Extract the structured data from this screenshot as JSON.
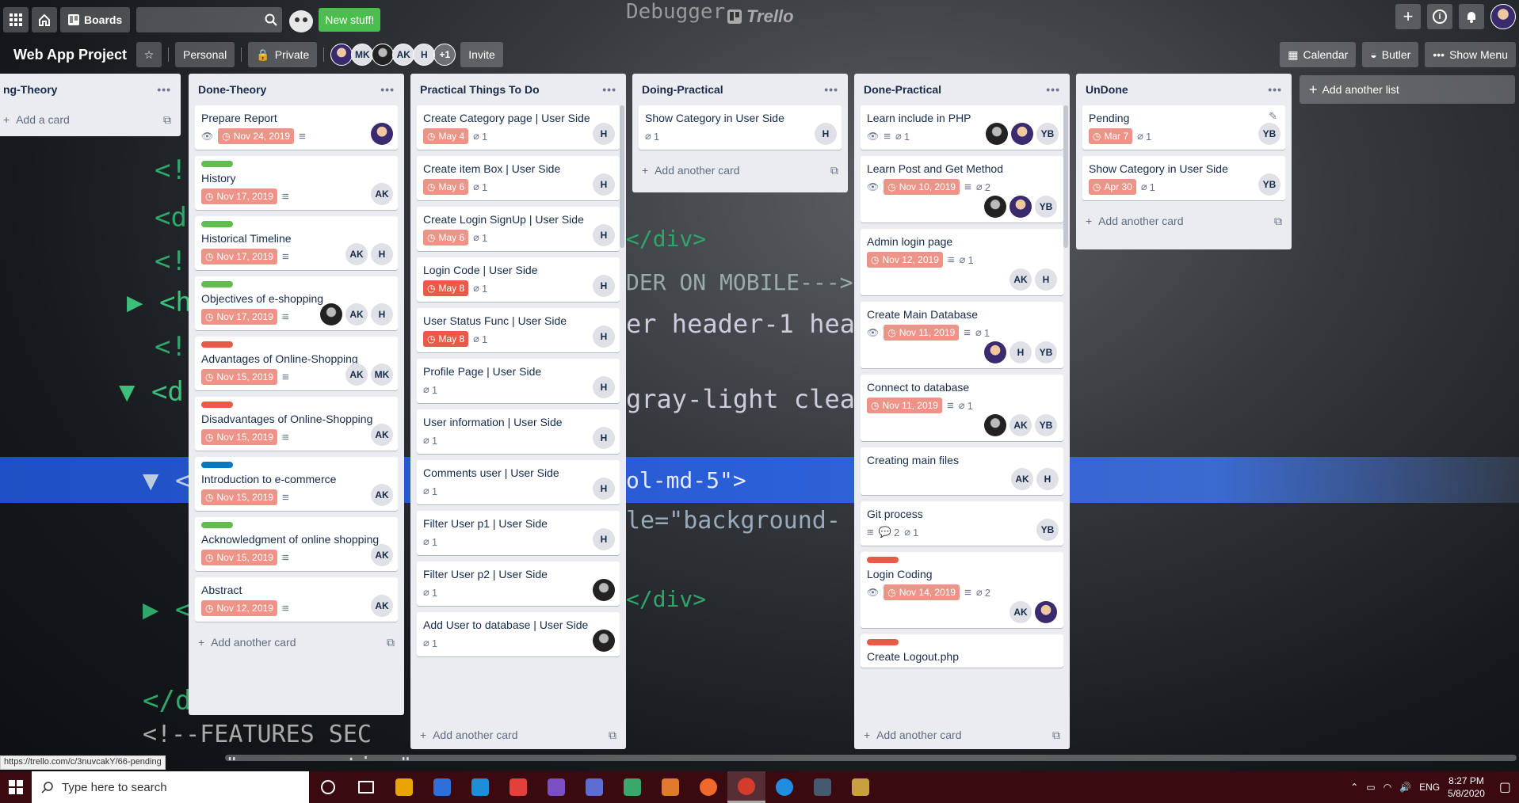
{
  "topbar": {
    "boards_label": "Boards",
    "new_stuff_label": "New stuff!",
    "logo_text": "Trello"
  },
  "board": {
    "title": "Web App Project",
    "team_label": "Personal",
    "visibility_label": "Private",
    "members": [
      "photo",
      "MK",
      "dark",
      "AK",
      "H"
    ],
    "members_more": "+1",
    "invite_label": "Invite",
    "calendar_label": "Calendar",
    "butler_label": "Butler",
    "show_menu_label": "Show Menu"
  },
  "lists": [
    {
      "title": "ng-Theory",
      "add_label": "Add a card",
      "cards": []
    },
    {
      "title": "Done-Theory",
      "add_label": "Add another card",
      "cards": [
        {
          "title": "Prepare Report",
          "watch": true,
          "due": "Nov 24, 2019",
          "desc": true,
          "members": [
            "photo"
          ]
        },
        {
          "label": "#61bd4f",
          "title": "History",
          "due": "Nov 17, 2019",
          "desc": true,
          "members": [
            "AK"
          ]
        },
        {
          "label": "#61bd4f",
          "title": "Historical Timeline",
          "due": "Nov 17, 2019",
          "desc": true,
          "members": [
            "AK",
            "H"
          ]
        },
        {
          "label": "#61bd4f",
          "title": "Objectives of e-shopping",
          "due": "Nov 17, 2019",
          "desc": true,
          "members": [
            "dark",
            "AK",
            "H"
          ]
        },
        {
          "label": "#eb5a46",
          "title": "Advantages of Online-Shopping",
          "due": "Nov 15, 2019",
          "desc": true,
          "members": [
            "AK",
            "MK"
          ]
        },
        {
          "label": "#eb5a46",
          "title": "Disadvantages of Online-Shopping",
          "due": "Nov 15, 2019",
          "desc": true,
          "members": [
            "AK"
          ]
        },
        {
          "label": "#0079bf",
          "title": "Introduction to e-commerce",
          "due": "Nov 15, 2019",
          "desc": true,
          "members": [
            "AK"
          ]
        },
        {
          "label": "#61bd4f",
          "title": "Acknowledgment of online shopping",
          "due": "Nov 15, 2019",
          "desc": true,
          "members": [
            "AK"
          ]
        },
        {
          "title": "Abstract",
          "due": "Nov 12, 2019",
          "desc": true,
          "members": [
            "AK"
          ]
        }
      ]
    },
    {
      "title": "Practical Things To Do",
      "add_label": "Add another card",
      "cards": [
        {
          "title": "Create Category page | User Side",
          "due": "May 4",
          "attach": "1",
          "members": [
            "H"
          ]
        },
        {
          "title": "Create item Box | User Side",
          "due": "May 6",
          "attach": "1",
          "members": [
            "H"
          ]
        },
        {
          "title": "Create Login SignUp | User Side",
          "due": "May 6",
          "attach": "1",
          "members": [
            "H"
          ]
        },
        {
          "title": "Login Code | User Side",
          "due": "May 8",
          "due_red": true,
          "attach": "1",
          "members": [
            "H"
          ]
        },
        {
          "title": "User Status Func | User Side",
          "due": "May 8",
          "due_red": true,
          "attach": "1",
          "members": [
            "H"
          ]
        },
        {
          "title": "Profile Page | User Side",
          "attach": "1",
          "members": [
            "H"
          ]
        },
        {
          "title": "User information | User Side",
          "attach": "1",
          "members": [
            "H"
          ]
        },
        {
          "title": "Comments user | User Side",
          "attach": "1",
          "members": [
            "H"
          ]
        },
        {
          "title": "Filter User p1 | User Side",
          "attach": "1",
          "members": [
            "H"
          ]
        },
        {
          "title": "Filter User p2 | User Side",
          "attach": "1",
          "members": [
            "dark"
          ]
        },
        {
          "title": "Add User to database | User Side",
          "attach": "1",
          "members": [
            "dark"
          ]
        }
      ]
    },
    {
      "title": "Doing-Practical",
      "add_label": "Add another card",
      "cards": [
        {
          "title": "Show Category in User Side",
          "attach": "1",
          "members": [
            "H"
          ]
        }
      ]
    },
    {
      "title": "Done-Practical",
      "add_label": "Add another card",
      "cards": [
        {
          "title": "Learn include in PHP",
          "watch": true,
          "desc": true,
          "attach": "1",
          "members": [
            "dark",
            "photo",
            "YB"
          ]
        },
        {
          "title": "Learn Post and Get Method",
          "watch": true,
          "due": "Nov 10, 2019",
          "desc": true,
          "attach": "2",
          "members": [
            "dark",
            "photo",
            "YB"
          ],
          "members_below": true
        },
        {
          "title": "Admin login page",
          "due": "Nov 12, 2019",
          "desc": true,
          "attach": "1",
          "members": [
            "AK",
            "H"
          ],
          "members_below": true
        },
        {
          "title": "Create Main Database",
          "watch": true,
          "due": "Nov 11, 2019",
          "desc": true,
          "attach": "1",
          "members": [
            "photo",
            "H",
            "YB"
          ],
          "members_below": true
        },
        {
          "title": "Connect to database",
          "due": "Nov 11, 2019",
          "desc": true,
          "attach": "1",
          "members": [
            "dark",
            "AK",
            "YB"
          ],
          "members_below": true
        },
        {
          "title": "Creating main files",
          "members": [
            "AK",
            "H"
          ]
        },
        {
          "title": "Git process",
          "desc": true,
          "comments": "2",
          "attach": "1",
          "members": [
            "YB"
          ]
        },
        {
          "label": "#eb5a46",
          "title": "Login Coding",
          "watch": true,
          "due": "Nov 14, 2019",
          "desc": true,
          "attach": "2",
          "members": [
            "AK",
            "photo"
          ],
          "members_below": true
        },
        {
          "label": "#eb5a46",
          "title": "Create Logout.php",
          "members": []
        }
      ]
    },
    {
      "title": "UnDone",
      "add_label": "Add another card",
      "cards": [
        {
          "title": "Pending",
          "due": "Mar 7",
          "attach": "1",
          "members": [
            "YB"
          ],
          "edit": true
        },
        {
          "title": "Show Category in User Side",
          "due": "Apr 30",
          "attach": "1",
          "members": [
            "YB"
          ]
        }
      ]
    }
  ],
  "add_list_label": "Add another list",
  "status_url": "https://trello.com/c/3nuvcakY/66-pending",
  "taskbar": {
    "search_placeholder": "Type here to search",
    "lang": "ENG",
    "time": "8:27 PM",
    "date": "5/8/2020",
    "app_colors": [
      "#e8a400",
      "#2e6fd9",
      "#1c8fd8",
      "#e2403a",
      "#7b4fc4",
      "#5a6fd0",
      "#3aa86a",
      "#e07a2c",
      "#ef6a2a",
      "#d33c2c",
      "#1f8de0",
      "#445a6e",
      "#c8a040"
    ]
  }
}
